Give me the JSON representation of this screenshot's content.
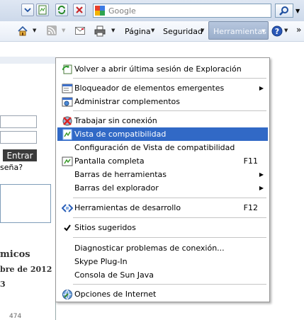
{
  "search": {
    "placeholder": "Google"
  },
  "commandbar": {
    "page_label": "Página",
    "security_label": "Seguridad",
    "tools_label": "Herramientas"
  },
  "page": {
    "enter_button": "Entrar",
    "password_link": "seña?",
    "heading": "micos",
    "date": "bre de 2012",
    "small": "3",
    "count": "474"
  },
  "menu": {
    "items": [
      {
        "label": "Volver a abrir última sesión de Exploración",
        "icon": "reopen-session-icon"
      },
      {
        "label": "Bloqueador de elementos emergentes",
        "icon": "popup-blocker-icon",
        "submenu": true
      },
      {
        "label": "Administrar complementos",
        "icon": "addons-icon"
      },
      {
        "label": "Trabajar sin conexión",
        "icon": "offline-icon"
      },
      {
        "label": "Vista de compatibilidad",
        "icon": "compatibility-view-icon",
        "selected": true
      },
      {
        "label": "Configuración de Vista de compatibilidad"
      },
      {
        "label": "Pantalla completa",
        "icon": "fullscreen-icon",
        "shortcut": "F11"
      },
      {
        "label": "Barras de herramientas",
        "submenu": true
      },
      {
        "label": "Barras del explorador",
        "submenu": true
      },
      {
        "label": "Herramientas de desarrollo",
        "icon": "developer-tools-icon",
        "shortcut": "F12"
      },
      {
        "label": "Sitios sugeridos",
        "icon": "checkmark-icon"
      },
      {
        "label": "Diagnosticar problemas de conexión..."
      },
      {
        "label": "Skype Plug-In"
      },
      {
        "label": "Consola de Sun Java"
      },
      {
        "label": "Opciones de Internet",
        "icon": "internet-options-icon"
      }
    ]
  },
  "colors": {
    "selection": "#3169c6"
  }
}
